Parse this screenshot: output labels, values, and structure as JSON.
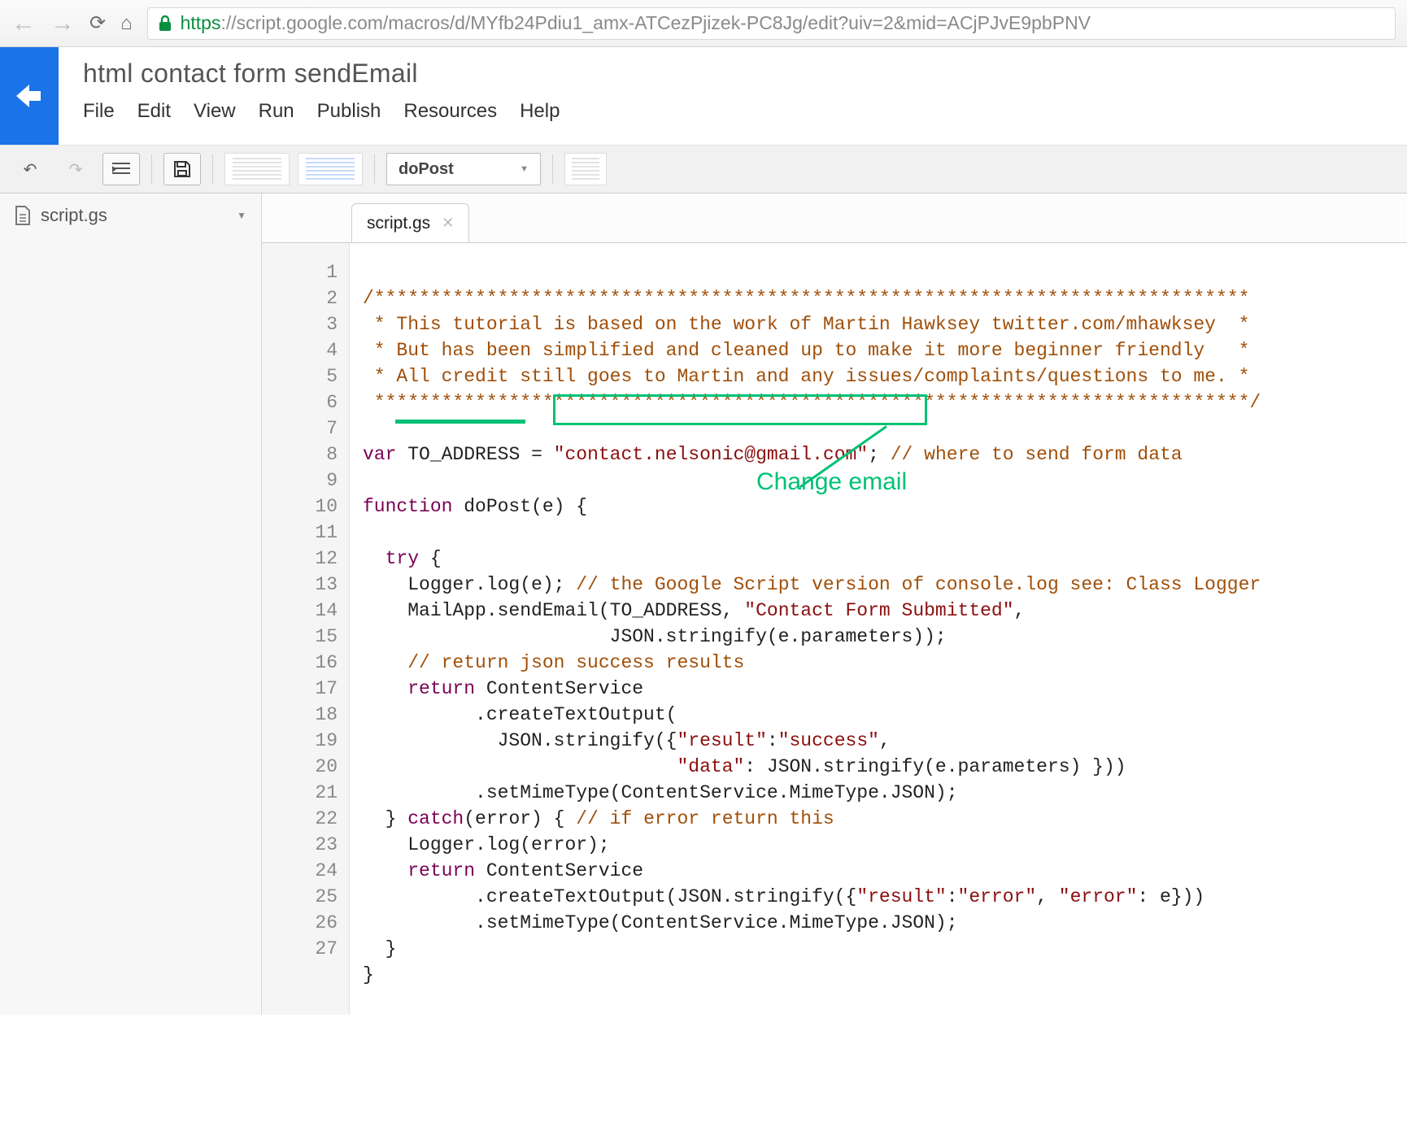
{
  "browser": {
    "url_https": "https",
    "url_rest": "://script.google.com/macros/d/MYfb24Pdiu1_amx-ATCezPjizek-PC8Jg/edit?uiv=2&mid=ACjPJvE9pbPNV"
  },
  "app": {
    "title": "html contact form sendEmail",
    "menus": [
      "File",
      "Edit",
      "View",
      "Run",
      "Publish",
      "Resources",
      "Help"
    ]
  },
  "toolbar": {
    "function_select": "doPost"
  },
  "sidebar": {
    "file": "script.gs"
  },
  "tab": {
    "label": "script.gs"
  },
  "gutter": {
    "first": 1,
    "last": 27
  },
  "code": {
    "l1": "/******************************************************************************",
    "l2": " * This tutorial is based on the work of Martin Hawksey twitter.com/mhawksey  *",
    "l3": " * But has been simplified and cleaned up to make it more beginner friendly   *",
    "l4": " * All credit still goes to Martin and any issues/complaints/questions to me. *",
    "l5": " ******************************************************************************/",
    "l6": "",
    "l7_var": "var",
    "l7_name": " TO_ADDRESS ",
    "l7_eq": "= ",
    "l7_str": "\"contact.nelsonic@gmail.com\"",
    "l7_sc": ";",
    "l7_cm": " // where to send form data",
    "l8": "",
    "l9_fn": "function",
    "l9_rest": " doPost(e) {",
    "l10": "",
    "l11_try": "  try",
    "l11_rest": " {",
    "l12a": "    Logger.log(e); ",
    "l12b": "// the Google Script version of console.log see: Class Logger",
    "l13a": "    MailApp.sendEmail(TO_ADDRESS, ",
    "l13b": "\"Contact Form Submitted\"",
    "l13c": ",",
    "l14": "                      JSON.stringify(e.parameters));",
    "l15": "    // return json success results",
    "l16_ret": "    return",
    "l16_rest": " ContentService",
    "l17": "          .createTextOutput(",
    "l18a": "            JSON.stringify({",
    "l18b": "\"result\"",
    "l18c": ":",
    "l18d": "\"success\"",
    "l18e": ",",
    "l19a": "                            ",
    "l19b": "\"data\"",
    "l19c": ": JSON.stringify(e.parameters) }))",
    "l20": "          .setMimeType(ContentService.MimeType.JSON);",
    "l21a": "  } ",
    "l21b": "catch",
    "l21c": "(error) { ",
    "l21d": "// if error return this",
    "l22": "    Logger.log(error);",
    "l23_ret": "    return",
    "l23_rest": " ContentService",
    "l24a": "          .createTextOutput(JSON.stringify({",
    "l24b": "\"result\"",
    "l24c": ":",
    "l24d": "\"error\"",
    "l24e": ", ",
    "l24f": "\"error\"",
    "l24g": ": e}))",
    "l25": "          .setMimeType(ContentService.MimeType.JSON);",
    "l26": "  }",
    "l27": "}"
  },
  "annotation": {
    "label": "Change email"
  }
}
